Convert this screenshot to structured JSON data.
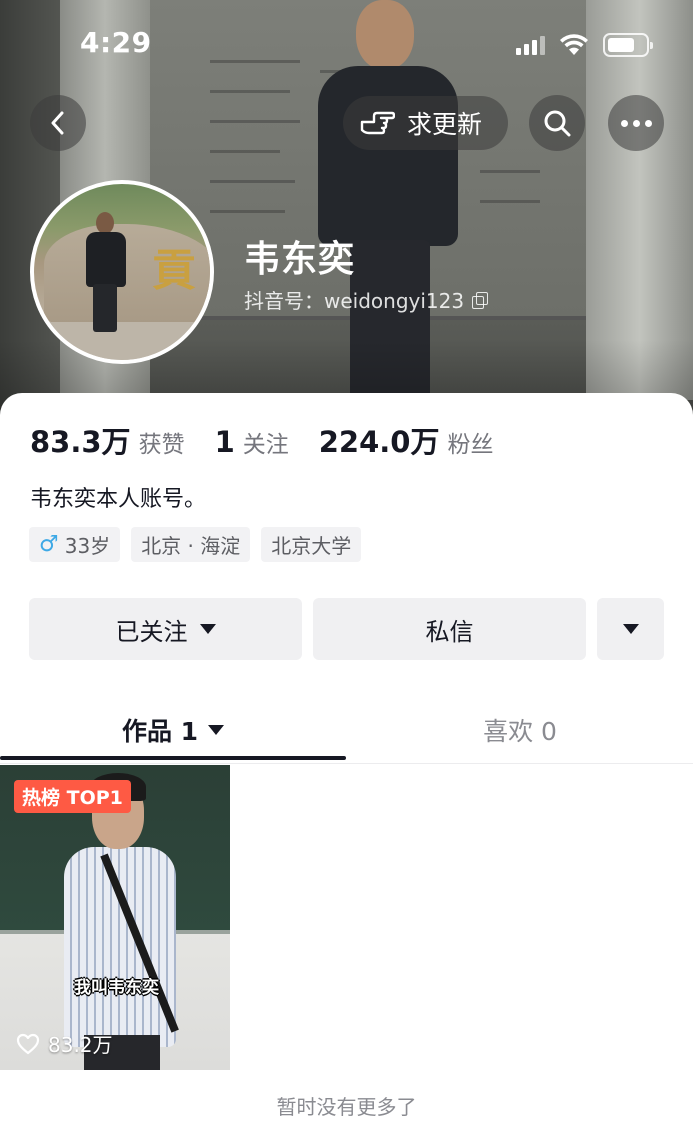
{
  "status_bar": {
    "time": "4:29"
  },
  "header": {
    "request_update_label": "求更新"
  },
  "profile": {
    "name": "韦东奕",
    "douyin_id": "抖音号：weidongyi123",
    "stats": [
      {
        "value": "83.3万",
        "label": "获赞"
      },
      {
        "value": "1",
        "label": "关注"
      },
      {
        "value": "224.0万",
        "label": "粉丝"
      }
    ],
    "bio": "韦东奕本人账号。",
    "tags": {
      "age": "33岁",
      "location": "北京 · 海淀",
      "school": "北京大学"
    }
  },
  "actions": {
    "followed_label": "已关注",
    "message_label": "私信"
  },
  "tabs": {
    "works_label": "作品 1",
    "likes_label": "喜欢 0"
  },
  "video": {
    "badge": "热榜 TOP1",
    "caption": "我叫韦东奕",
    "likes": "83.2万"
  },
  "footer": {
    "no_more": "暂时没有更多了"
  },
  "colors": {
    "badge_bg": "#fe5a44",
    "text_primary": "#161823",
    "text_secondary": "#75767d",
    "male_icon": "#3ea9e6"
  }
}
